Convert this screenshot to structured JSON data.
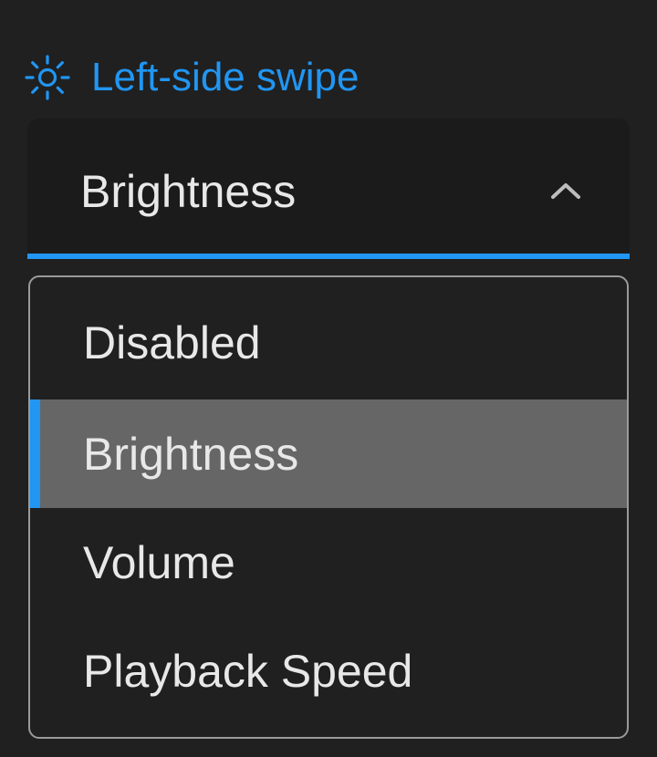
{
  "setting": {
    "label": "Left-side swipe",
    "icon": "brightness-icon"
  },
  "select": {
    "value": "Brightness",
    "expanded": true
  },
  "options": [
    {
      "label": "Disabled",
      "selected": false
    },
    {
      "label": "Brightness",
      "selected": true
    },
    {
      "label": "Volume",
      "selected": false
    },
    {
      "label": "Playback Speed",
      "selected": false
    }
  ],
  "colors": {
    "background": "#202020",
    "accent": "#2196f3",
    "field_background": "#1b1b1b",
    "selected_row": "#666666",
    "text": "#e8e8e8"
  }
}
